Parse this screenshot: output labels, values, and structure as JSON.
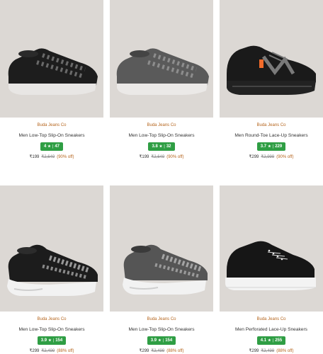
{
  "products": [
    {
      "brand": "Buda Jeans Co",
      "name": "Men Low-Top Slip-On Sneakers",
      "rating": "4",
      "star": "★",
      "reviews": "47",
      "price": "₹199",
      "mrp": "₹2,649",
      "discount": "(90% off)",
      "shoe_color": "#1d1d1d",
      "accent_color": "#8a8a8a"
    },
    {
      "brand": "Buda Jeans Co",
      "name": "Men Low-Top Slip-On Sneakers",
      "rating": "3.8",
      "star": "★",
      "reviews": "32",
      "price": "₹199",
      "mrp": "₹2,649",
      "discount": "(90% off)",
      "shoe_color": "#5a5a5a",
      "accent_color": "#9a9a9a"
    },
    {
      "brand": "Buda Jeans Co",
      "name": "Men Round-Toe Lace-Up Sneakers",
      "rating": "3.7",
      "star": "★",
      "reviews": "229",
      "price": "₹299",
      "mrp": "₹2,999",
      "discount": "(90% off)",
      "shoe_color": "#1a1a1a",
      "accent_color": "#f26b2a"
    },
    {
      "brand": "Buda Jeans Co",
      "name": "Men Low-Top Slip-On Sneakers",
      "rating": "3.9",
      "star": "★",
      "reviews": "154",
      "price": "₹299",
      "mrp": "₹2,499",
      "discount": "(88% off)",
      "shoe_color": "#1c1c1c",
      "accent_color": "#b8b8b8"
    },
    {
      "brand": "Buda Jeans Co",
      "name": "Men Low-Top Slip-On Sneakers",
      "rating": "3.9",
      "star": "★",
      "reviews": "154",
      "price": "₹299",
      "mrp": "₹2,499",
      "discount": "(88% off)",
      "shoe_color": "#555555",
      "accent_color": "#b8b8b8"
    },
    {
      "brand": "Buda Jeans Co",
      "name": "Men Perforated Lace-Up Sneakers",
      "rating": "4.1",
      "star": "★",
      "reviews": "255",
      "price": "₹299",
      "mrp": "₹2,499",
      "discount": "(88% off)",
      "shoe_color": "#161616",
      "accent_color": "#f3f3f3"
    }
  ]
}
